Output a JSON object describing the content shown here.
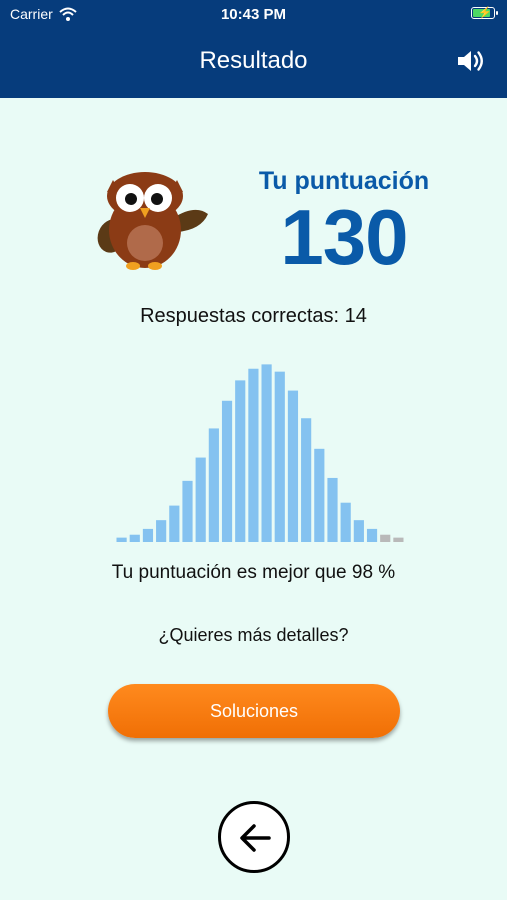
{
  "status_bar": {
    "carrier": "Carrier",
    "time": "10:43 PM"
  },
  "nav": {
    "title": "Resultado",
    "sound_icon": "speaker-icon"
  },
  "score": {
    "label": "Tu puntuación",
    "value": "130"
  },
  "correct_answers": "Respuestas correctas: 14",
  "percentile_text": "Tu puntuación es mejor que 98 %",
  "details_prompt": "¿Quieres más detalles?",
  "solutions_button": "Soluciones",
  "back_icon": "arrow-left-icon",
  "colors": {
    "header": "#063c7c",
    "background": "#e9fbf6",
    "score": "#0a5aa8",
    "button": "#f57a0f",
    "bar": "#84c2f0",
    "bar_beyond": "#b9b9b9"
  },
  "chart_data": {
    "type": "bar",
    "values": [
      3,
      5,
      9,
      15,
      25,
      42,
      58,
      78,
      97,
      111,
      119,
      122,
      117,
      104,
      85,
      64,
      44,
      27,
      15,
      9,
      5,
      3
    ],
    "highlighted_from_index": 20,
    "ylim": [
      0,
      125
    ]
  }
}
